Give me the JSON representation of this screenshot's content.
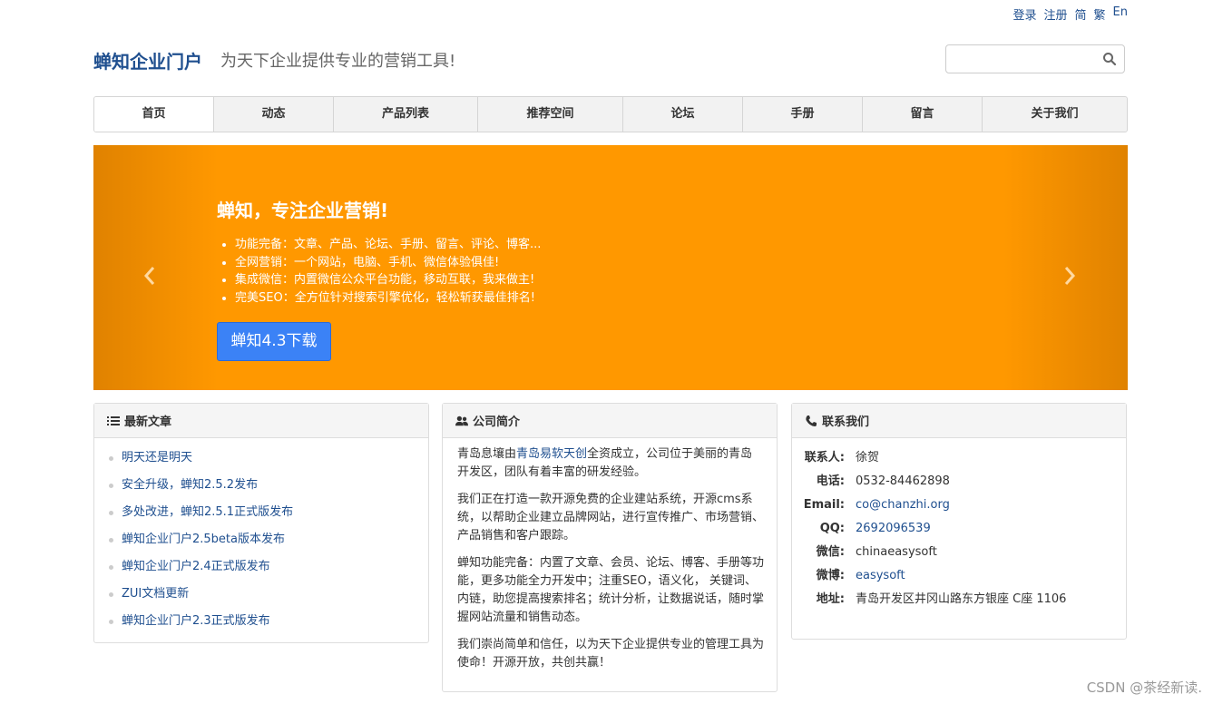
{
  "topbar": {
    "login": "登录",
    "register": "注册",
    "simplified": "简",
    "traditional": "繁",
    "english": "En"
  },
  "header": {
    "logo": "蝉知企业门户",
    "slogan": "为天下企业提供专业的营销工具!",
    "search_placeholder": ""
  },
  "nav": {
    "items": [
      {
        "label": "首页"
      },
      {
        "label": "动态"
      },
      {
        "label": "产品列表"
      },
      {
        "label": "推荐空间"
      },
      {
        "label": "论坛"
      },
      {
        "label": "手册"
      },
      {
        "label": "留言"
      },
      {
        "label": "关于我们"
      }
    ]
  },
  "banner": {
    "title": "蝉知，专注企业营销!",
    "bullets": [
      "功能完备：文章、产品、论坛、手册、留言、评论、博客...",
      "全网营销：一个网站，电脑、手机、微信体验俱佳!",
      "集成微信：内置微信公众平台功能，移动互联，我来做主!",
      "完美SEO：全方位针对搜索引擎优化，轻松斩获最佳排名!"
    ],
    "button": "蝉知4.3下载",
    "color": "#ff9800"
  },
  "latest": {
    "title": "最新文章",
    "items": [
      "明天还是明天",
      "安全升级，蝉知2.5.2发布",
      "多处改进，蝉知2.5.1正式版发布",
      "蝉知企业门户2.5beta版本发布",
      "蝉知企业门户2.4正式版发布",
      "ZUI文档更新",
      "蝉知企业门户2.3正式版发布"
    ]
  },
  "about": {
    "title": "公司简介",
    "p1_pre": "青岛息壤由",
    "p1_link": "青岛易软天创",
    "p1_post": "全资成立，公司位于美丽的青岛开发区，团队有着丰富的研发经验。",
    "p2": "我们正在打造一款开源免费的企业建站系统，开源cms系统，以帮助企业建立品牌网站，进行宣传推广、市场营销、产品销售和客户跟踪。",
    "p3": "蝉知功能完备：内置了文章、会员、论坛、博客、手册等功能，更多功能全力开发中；注重SEO，语义化， 关键词、内链，助您提高搜索排名；统计分析，让数据说话，随时掌握网站流量和销售动态。",
    "p4": "我们崇尚简单和信任，以为天下企业提供专业的管理工具为使命！开源开放，共创共赢！"
  },
  "contact": {
    "title": "联系我们",
    "rows": [
      {
        "k": "联系人:",
        "v": "徐贺"
      },
      {
        "k": "电话:",
        "v": "0532-84462898"
      },
      {
        "k": "Email:",
        "v": "co@chanzhi.org"
      },
      {
        "k": "QQ:",
        "v": "2692096539"
      },
      {
        "k": "微信:",
        "v": "chinaeasysoft"
      },
      {
        "k": "微博:",
        "v": "easysoft"
      },
      {
        "k": "地址:",
        "v": "青岛开发区井冈山路东方银座 C座 1106"
      }
    ]
  },
  "watermark": "CSDN @茶经新读."
}
